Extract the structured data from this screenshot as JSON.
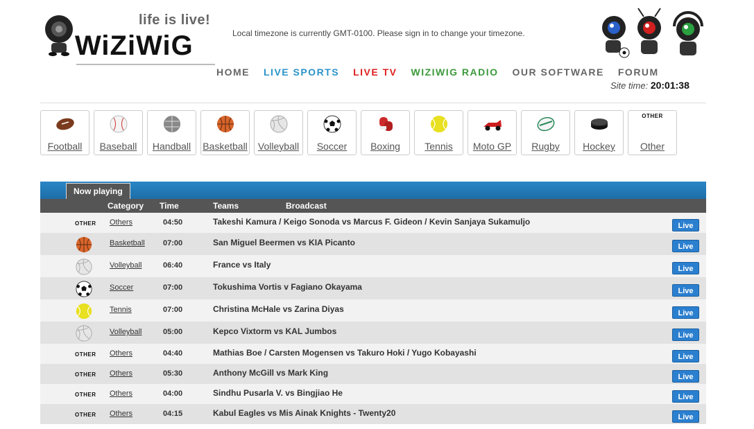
{
  "logo": {
    "tagline": "life is live!",
    "wordmark": "WiZiWiG"
  },
  "timezone_notice": "Local timezone is currently GMT-0100. Please sign in to change your timezone.",
  "nav": [
    {
      "label": "HOME",
      "color": "#666666"
    },
    {
      "label": "LIVE SPORTS",
      "color": "#2a93c9"
    },
    {
      "label": "LIVE TV",
      "color": "#e02020"
    },
    {
      "label": "WIZIWIG RADIO",
      "color": "#3c9a3c"
    },
    {
      "label": "OUR SOFTWARE",
      "color": "#666666"
    },
    {
      "label": "FORUM",
      "color": "#666666"
    }
  ],
  "site_time": {
    "label": "Site time:",
    "value": "20:01:38"
  },
  "sports": [
    {
      "label": "Football",
      "icon": "american-football-icon"
    },
    {
      "label": "Baseball",
      "icon": "baseball-icon"
    },
    {
      "label": "Handball",
      "icon": "handball-icon"
    },
    {
      "label": "Basketball",
      "icon": "basketball-icon"
    },
    {
      "label": "Volleyball",
      "icon": "volleyball-icon"
    },
    {
      "label": "Soccer",
      "icon": "soccer-ball-icon"
    },
    {
      "label": "Boxing",
      "icon": "boxing-glove-icon"
    },
    {
      "label": "Tennis",
      "icon": "tennis-ball-icon"
    },
    {
      "label": "Moto GP",
      "icon": "race-car-icon"
    },
    {
      "label": "Rugby",
      "icon": "rugby-ball-icon"
    },
    {
      "label": "Hockey",
      "icon": "hockey-puck-icon"
    },
    {
      "label": "Other",
      "icon": "other-icon",
      "icon_text": "OTHER"
    }
  ],
  "table": {
    "tab": "Now playing",
    "headers": {
      "category": "Category",
      "time": "Time",
      "teams": "Teams",
      "broadcast": "Broadcast"
    },
    "live_label": "Live",
    "rows": [
      {
        "icon": "other",
        "category": "Others",
        "time": "04:50",
        "teams": "Takeshi Kamura / Keigo Sonoda vs Marcus F. Gideon / Kevin Sanjaya Sukamuljo"
      },
      {
        "icon": "basketball",
        "category": "Basketball",
        "time": "07:00",
        "teams": "San Miguel Beermen vs KIA Picanto"
      },
      {
        "icon": "volleyball",
        "category": "Volleyball",
        "time": "06:40",
        "teams": "France vs Italy"
      },
      {
        "icon": "soccer",
        "category": "Soccer",
        "time": "07:00",
        "teams": "Tokushima Vortis v Fagiano Okayama"
      },
      {
        "icon": "tennis",
        "category": "Tennis",
        "time": "07:00",
        "teams": "Christina McHale vs Zarina Diyas"
      },
      {
        "icon": "volleyball",
        "category": "Volleyball",
        "time": "05:00",
        "teams": "Kepco Vixtorm vs KAL Jumbos"
      },
      {
        "icon": "other",
        "category": "Others",
        "time": "04:40",
        "teams": "Mathias Boe / Carsten Mogensen vs Takuro Hoki / Yugo Kobayashi"
      },
      {
        "icon": "other",
        "category": "Others",
        "time": "05:30",
        "teams": "Anthony McGill vs Mark King"
      },
      {
        "icon": "other",
        "category": "Others",
        "time": "04:00",
        "teams": "Sindhu Pusarla V. vs Bingjiao He"
      },
      {
        "icon": "other",
        "category": "Others",
        "time": "04:15",
        "teams": "Kabul Eagles vs Mis Ainak Knights - Twenty20"
      }
    ]
  }
}
